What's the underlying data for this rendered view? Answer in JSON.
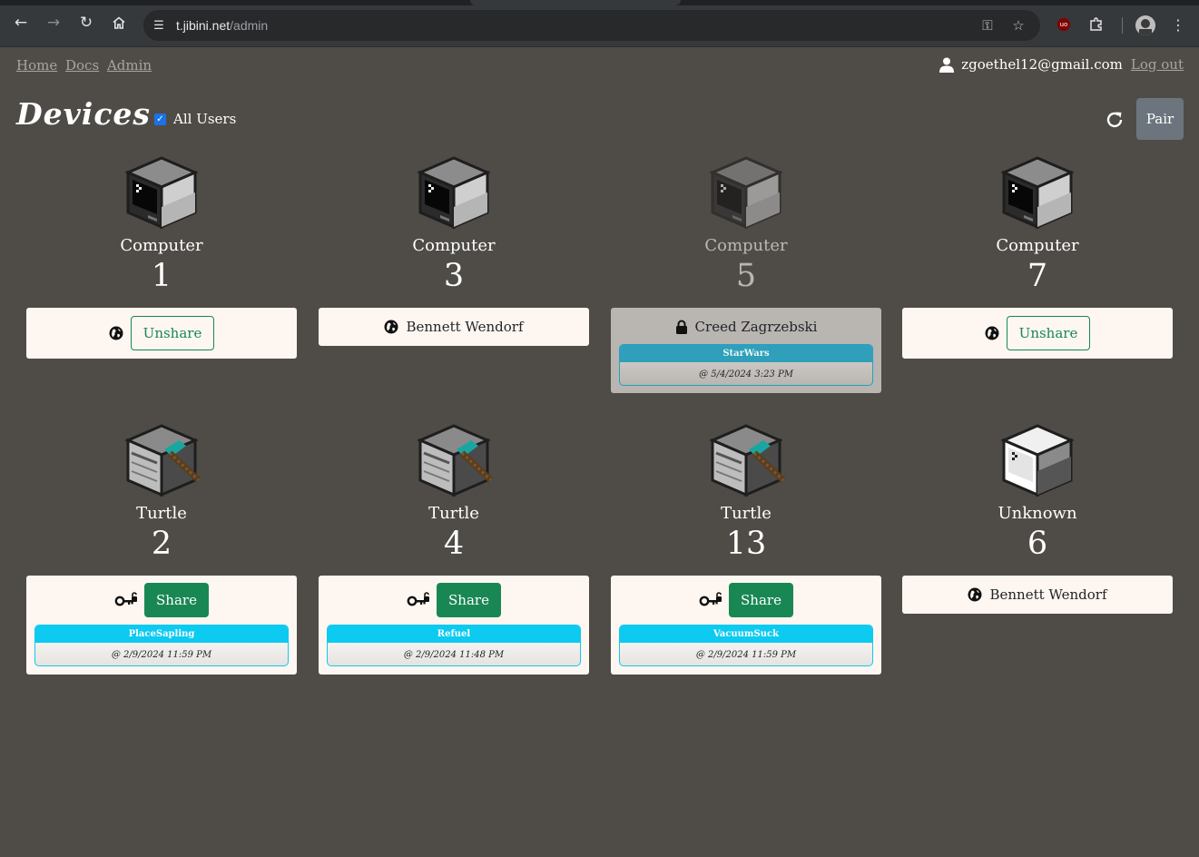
{
  "browser": {
    "url_host": "t.jibini.net",
    "url_path": "/admin"
  },
  "nav": {
    "home": "Home",
    "docs": "Docs",
    "admin": "Admin"
  },
  "user": {
    "email": "zgoethel12@gmail.com",
    "logout": "Log out"
  },
  "page": {
    "title": "Devices",
    "all_users_label": "All Users",
    "all_users_checked": true,
    "pair_label": "Pair"
  },
  "devices": [
    {
      "type": "Computer",
      "id": "1",
      "shared": true,
      "button": "Unshare"
    },
    {
      "type": "Computer",
      "id": "3",
      "owner": "Bennett Wendorf"
    },
    {
      "type": "Computer",
      "id": "5",
      "locked_by": "Creed Zagrzebski",
      "task": "StarWars",
      "task_time": "@ 5/4/2024 3:23 PM"
    },
    {
      "type": "Computer",
      "id": "7",
      "shared": true,
      "button": "Unshare"
    },
    {
      "type": "Turtle",
      "id": "2",
      "button": "Share",
      "task": "PlaceSapling",
      "task_time": "@ 2/9/2024 11:59 PM"
    },
    {
      "type": "Turtle",
      "id": "4",
      "button": "Share",
      "task": "Refuel",
      "task_time": "@ 2/9/2024 11:48 PM"
    },
    {
      "type": "Turtle",
      "id": "13",
      "button": "Share",
      "task": "VacuumSuck",
      "task_time": "@ 2/9/2024 11:59 PM"
    },
    {
      "type": "Unknown",
      "id": "6",
      "owner": "Bennett Wendorf"
    }
  ],
  "colors": {
    "background": "#4f4c47",
    "panel": "#fdf6f1",
    "locked_panel": "#b9b5b1",
    "share_green": "#198754",
    "task_cyan": "#0dcaf0",
    "pair_gray": "#6c757d"
  }
}
